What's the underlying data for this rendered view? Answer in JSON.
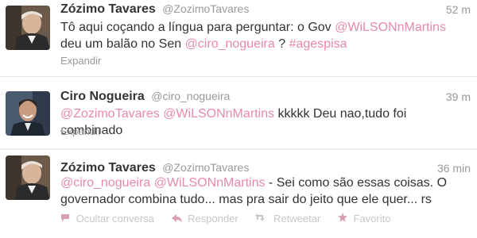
{
  "tweets": [
    {
      "fullname": "Zózimo Tavares",
      "username": "@ZozimoTavares",
      "time": "52 m",
      "text_parts": [
        {
          "type": "text",
          "value": "Tô aqui coçando a língua para perguntar: o Gov "
        },
        {
          "type": "mention",
          "value": "@WiLSONnMartins"
        },
        {
          "type": "text",
          "value": " deu um balão no Sen "
        },
        {
          "type": "mention",
          "value": "@ciro_nogueira"
        },
        {
          "type": "text",
          "value": " ? "
        },
        {
          "type": "hashtag",
          "value": "#agespisa"
        }
      ],
      "expand_label": "Expandir"
    },
    {
      "fullname": "Ciro Nogueira",
      "username": "@ciro_nogueira",
      "time": "39 m",
      "text_parts": [
        {
          "type": "mention",
          "value": "@ZozimoTavares"
        },
        {
          "type": "text",
          "value": " "
        },
        {
          "type": "mention",
          "value": "@WiLSONnMartins"
        },
        {
          "type": "text",
          "value": " kkkkk Deu nao,tudo foi combinado"
        }
      ],
      "expand_label": "Expandir"
    },
    {
      "fullname": "Zózimo Tavares",
      "username": "@ZozimoTavares",
      "time": "36 min",
      "text_parts": [
        {
          "type": "mention",
          "value": "@ciro_nogueira"
        },
        {
          "type": "text",
          "value": " "
        },
        {
          "type": "mention",
          "value": "@WiLSONnMartins"
        },
        {
          "type": "text",
          "value": " - Sei como são essas coisas. O governador combina tudo... mas pra sair do jeito que ele quer... rs"
        }
      ],
      "actions": [
        {
          "icon": "speech-bubble-icon",
          "label": "Ocultar conversa"
        },
        {
          "icon": "reply-arrow-icon",
          "label": "Responder"
        },
        {
          "icon": "retweet-icon",
          "label": "Retweetar"
        },
        {
          "icon": "star-icon",
          "label": "Favorito"
        }
      ]
    }
  ],
  "colors": {
    "link": "#e98aa6",
    "muted": "#999999",
    "action": "#c7c7c7",
    "action_icon": "#d9a0b3"
  }
}
